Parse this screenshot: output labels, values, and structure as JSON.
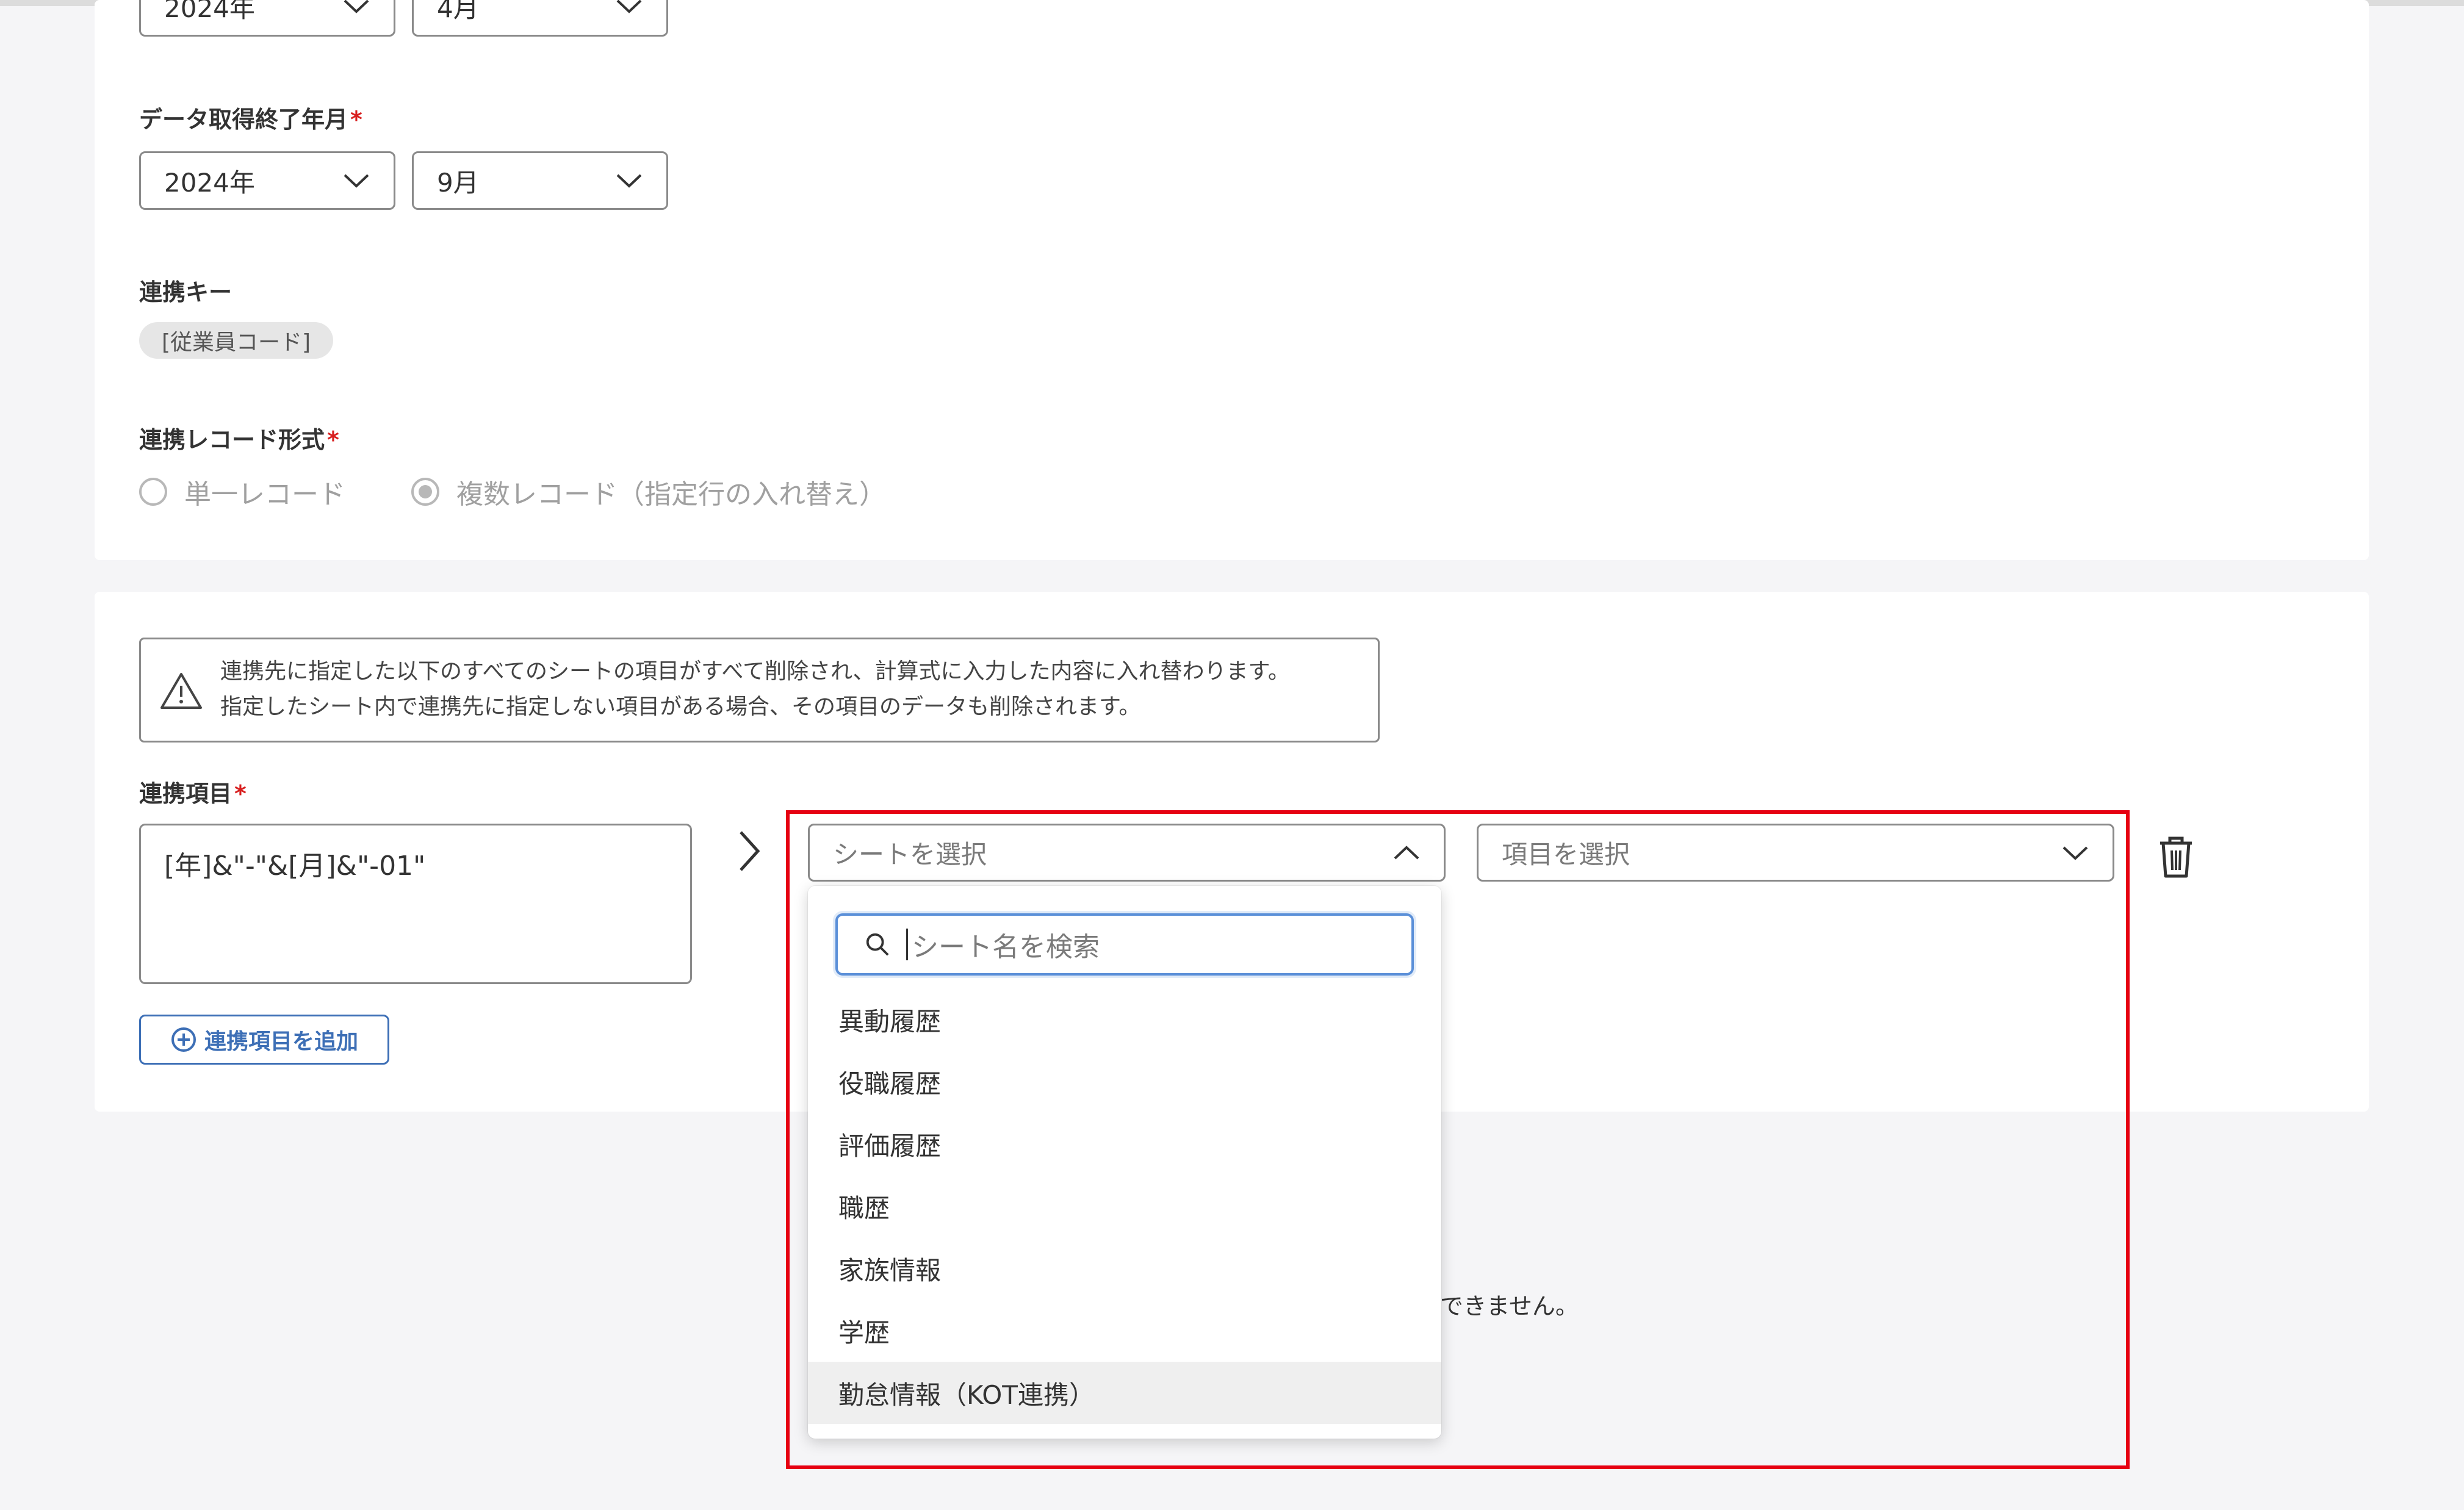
{
  "colors": {
    "page_bg": "#f5f5f7",
    "card_bg": "#ffffff",
    "required": "#d81f1f",
    "accent": "#3d6fb6",
    "highlight_frame": "#e60012",
    "search_focus": "#5a8fd8"
  },
  "start_period": {
    "year": "2024年",
    "month": "4月"
  },
  "end_period": {
    "label": "データ取得終了年月",
    "required_mark": "*",
    "year": "2024年",
    "month": "9月"
  },
  "link_key": {
    "label": "連携キー",
    "value": "[従業員コード]"
  },
  "record_format": {
    "label": "連携レコード形式",
    "required_mark": "*",
    "options": [
      {
        "label": "単一レコード",
        "selected": false
      },
      {
        "label": "複数レコード（指定行の入れ替え）",
        "selected": true
      }
    ]
  },
  "warning": {
    "icon": "warning-triangle-icon",
    "line1": "連携先に指定した以下のすべてのシートの項目がすべて削除され、計算式に入力した内容に入れ替わります。",
    "line2": "指定したシート内で連携先に指定しない項目がある場合、その項目のデータも削除されます。"
  },
  "link_items": {
    "label": "連携項目",
    "required_mark": "*",
    "formula": "[年]&\"-\"&[月]&\"-01\"",
    "sheet_select_placeholder": "シートを選択",
    "item_select_placeholder": "項目を選択",
    "add_button_label": "連携項目を追加"
  },
  "dropdown": {
    "search_placeholder": "シート名を検索",
    "options": [
      "異動履歴",
      "役職履歴",
      "評価履歴",
      "職歴",
      "家族情報",
      "学歴",
      "勤怠情報（KOT連携）"
    ],
    "highlighted_index": 6
  },
  "background_text": {
    "partial_message": "できません。"
  }
}
